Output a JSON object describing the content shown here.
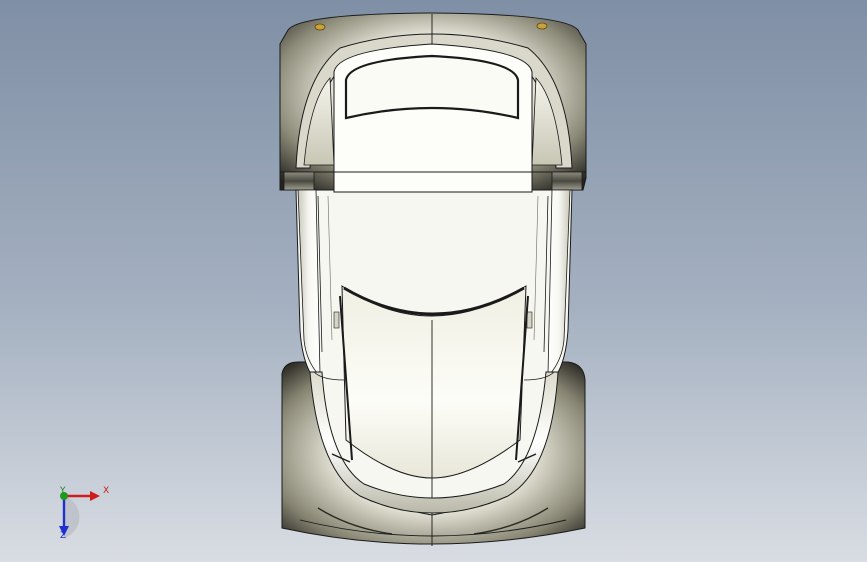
{
  "viewport": {
    "background_top": "#7f8fa5",
    "background_bottom": "#d9dde3"
  },
  "model": {
    "body_color": "#f7f7f2",
    "shadow_color": "#2c2b24",
    "edge_color": "#1a1a1a"
  },
  "triad": {
    "x_label": "X",
    "y_label": "Y",
    "z_label": "Z",
    "x_color": "#d01c1c",
    "y_color": "#1f9a1f",
    "z_color": "#1f2fd0"
  }
}
